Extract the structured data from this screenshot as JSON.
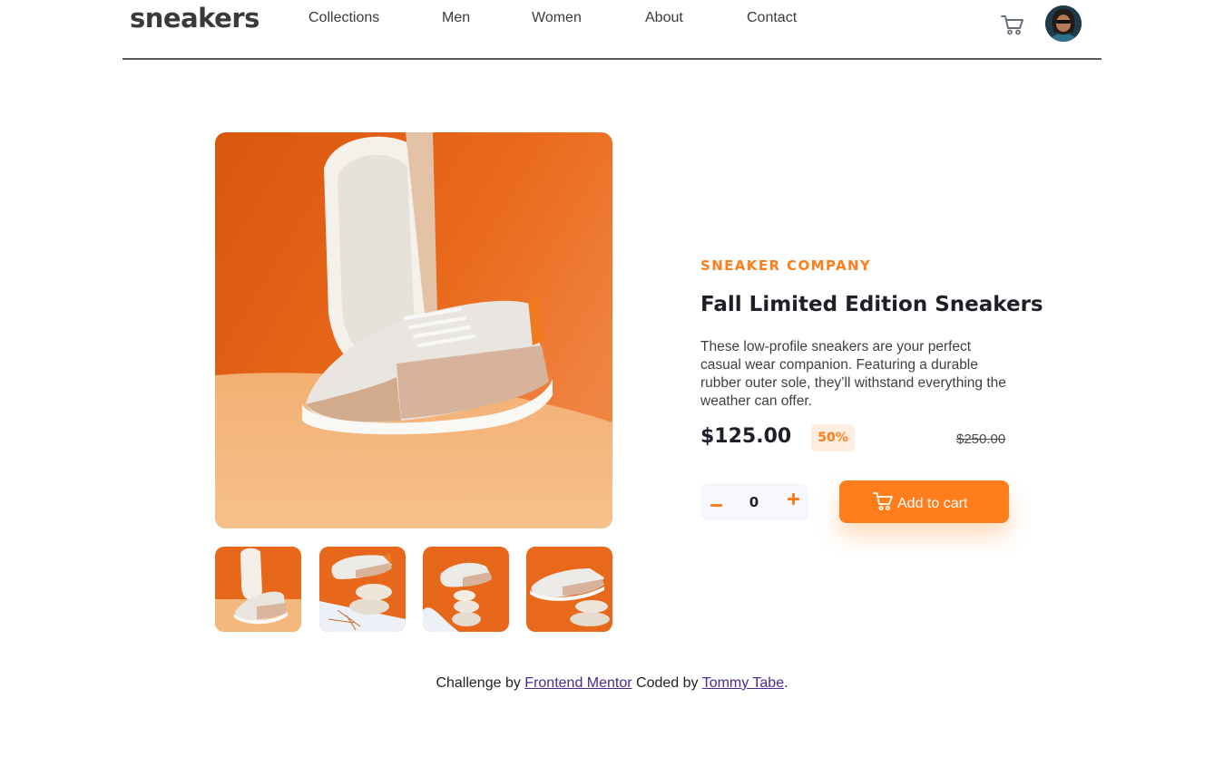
{
  "header": {
    "logo": "sneakers",
    "nav": [
      "Collections",
      "Men",
      "Women",
      "About",
      "Contact"
    ],
    "cart_icon": "cart-icon",
    "avatar_icon": "avatar"
  },
  "product": {
    "company": "SNEAKER COMPANY",
    "title": "Fall Limited Edition Sneakers",
    "description": "These low-profile sneakers are your perfect casual wear companion. Featuring a durable rubber outer sole, they’ll withstand everything the weather can offer.",
    "price": "$125.00",
    "discount": "50%",
    "old_price": "$250.00",
    "quantity": "0",
    "add_to_cart": "Add to cart"
  },
  "footer": {
    "challenge_by": "Challenge by",
    "mentor_link": "Frontend Mentor",
    "coded_by": "Coded by",
    "author_link": "Tommy Tabe",
    "period": "."
  },
  "colors": {
    "accent": "#ff7d1a",
    "accent_pale": "#ffede0",
    "dark_text": "#1d2026",
    "link": "#4b2b8f"
  }
}
